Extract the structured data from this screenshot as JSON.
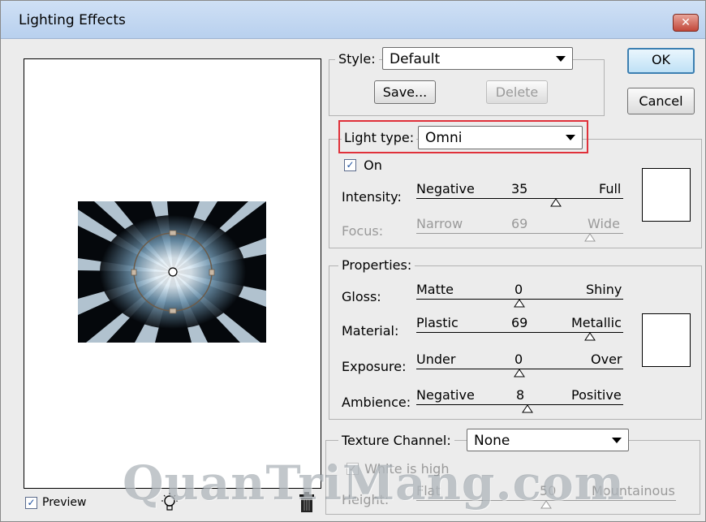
{
  "window": {
    "title": "Lighting Effects",
    "close_label": "✕"
  },
  "style": {
    "label": "Style:",
    "value": "Default",
    "save_label": "Save...",
    "delete_label": "Delete"
  },
  "buttons": {
    "ok": "OK",
    "cancel": "Cancel"
  },
  "light": {
    "type_label": "Light type:",
    "type_value": "Omni",
    "on_label": "On",
    "on_checked": true,
    "intensity": {
      "label": "Intensity:",
      "left": "Negative",
      "value": "35",
      "right": "Full"
    },
    "focus": {
      "label": "Focus:",
      "left": "Narrow",
      "value": "69",
      "right": "Wide"
    }
  },
  "properties": {
    "label": "Properties:",
    "gloss": {
      "label": "Gloss:",
      "left": "Matte",
      "value": "0",
      "right": "Shiny"
    },
    "material": {
      "label": "Material:",
      "left": "Plastic",
      "value": "69",
      "right": "Metallic"
    },
    "exposure": {
      "label": "Exposure:",
      "left": "Under",
      "value": "0",
      "right": "Over"
    },
    "ambience": {
      "label": "Ambience:",
      "left": "Negative",
      "value": "8",
      "right": "Positive"
    }
  },
  "texture": {
    "label": "Texture Channel:",
    "value": "None",
    "white_is_high": "White is high",
    "height_label": "Height:",
    "left": "Flat",
    "value_num": "50",
    "right": "Mountainous"
  },
  "preview": {
    "label": "Preview",
    "checked": true
  },
  "watermark": "QuanTriMang.com"
}
